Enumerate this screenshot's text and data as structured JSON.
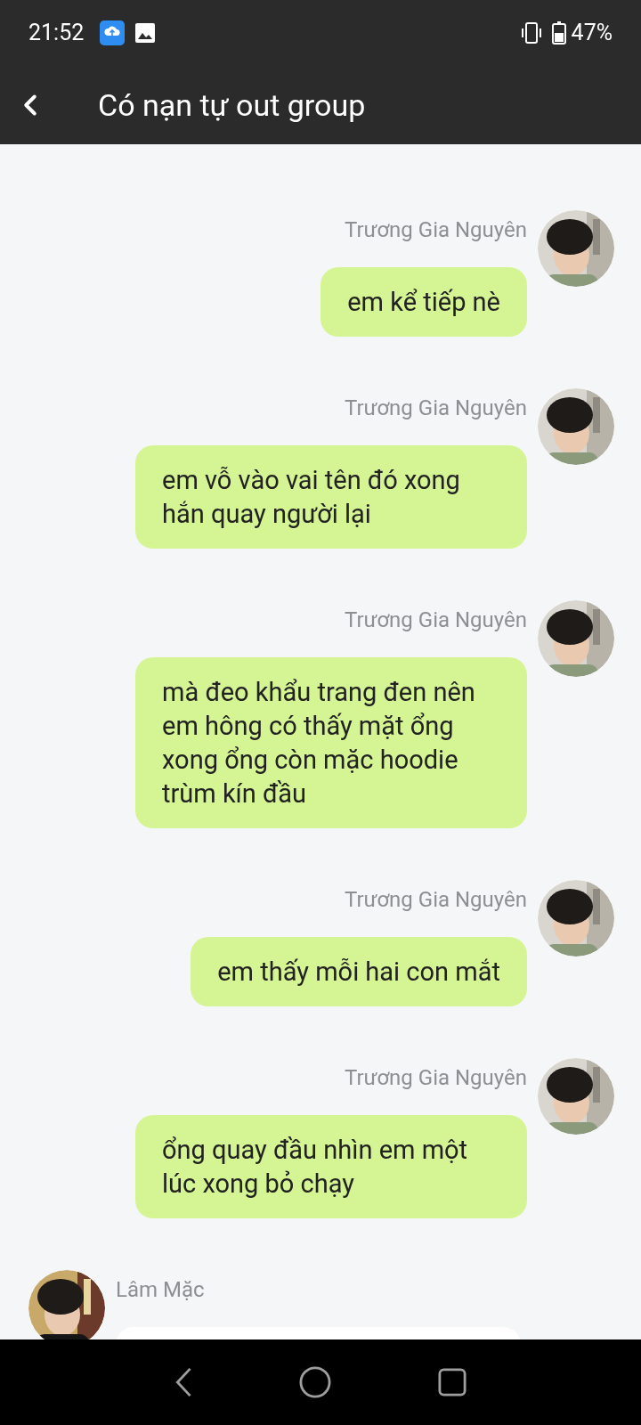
{
  "status_bar": {
    "time": "21:52",
    "battery": "47%"
  },
  "header": {
    "title": "Có nạn tự out group"
  },
  "messages": [
    {
      "kind": "outgoing",
      "sender": "Trương Gia Nguyên",
      "text": "em kể tiếp nè"
    },
    {
      "kind": "outgoing",
      "sender": "Trương Gia Nguyên",
      "text": "em vỗ vào vai tên đó xong hắn quay người lại"
    },
    {
      "kind": "outgoing",
      "sender": "Trương Gia Nguyên",
      "text": "mà đeo khẩu trang đen nên em hông có thấy mặt ổng xong ổng còn mặc hoodie trùm kín đầu"
    },
    {
      "kind": "outgoing",
      "sender": "Trương Gia Nguyên",
      "text": "em thấy mỗi hai con mắt"
    },
    {
      "kind": "outgoing",
      "sender": "Trương Gia Nguyên",
      "text": "ổng quay đầu nhìn em một lúc xong bỏ chạy"
    },
    {
      "kind": "incoming",
      "sender": "Lâm Mặc"
    }
  ]
}
